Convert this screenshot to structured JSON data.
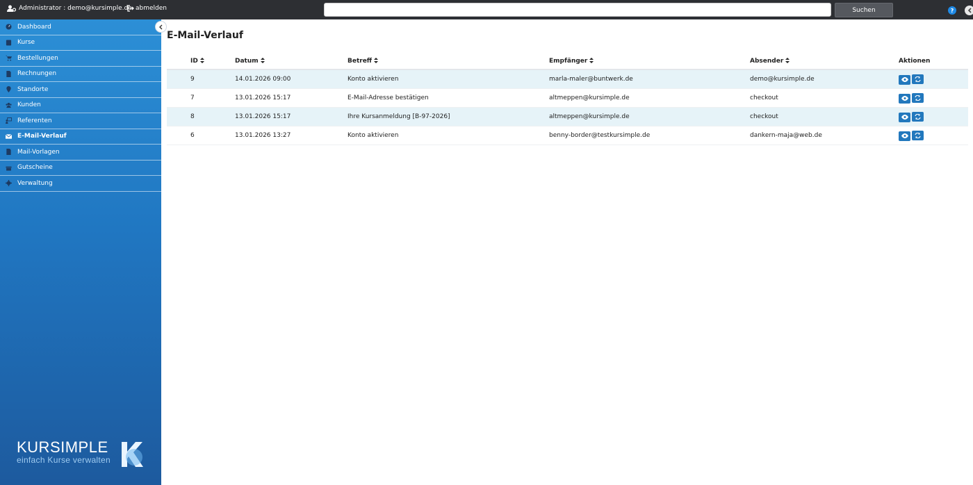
{
  "header": {
    "user_label": "Administrator : demo@kursimple.de",
    "logout_label": "abmelden",
    "search_placeholder": "",
    "search_button": "Suchen",
    "help_label": "?"
  },
  "sidebar": {
    "items": [
      {
        "label": "Dashboard",
        "icon": "dashboard-icon"
      },
      {
        "label": "Kurse",
        "icon": "book-icon"
      },
      {
        "label": "Bestellungen",
        "icon": "cart-icon"
      },
      {
        "label": "Rechnungen",
        "icon": "file-icon"
      },
      {
        "label": "Standorte",
        "icon": "map-marker-icon"
      },
      {
        "label": "Kunden",
        "icon": "users-icon"
      },
      {
        "label": "Referenten",
        "icon": "teacher-icon"
      },
      {
        "label": "E-Mail-Verlauf",
        "icon": "envelope-icon",
        "active": true
      },
      {
        "label": "Mail-Vorlagen",
        "icon": "document-icon"
      },
      {
        "label": "Gutscheine",
        "icon": "gift-icon"
      },
      {
        "label": "Verwaltung",
        "icon": "gear-icon"
      }
    ],
    "logo_name": "KURSIMPLE",
    "logo_tagline": "einfach Kurse verwalten"
  },
  "main": {
    "title": "E-Mail-Verlauf",
    "columns": {
      "id": "ID",
      "date": "Datum",
      "subject": "Betreff",
      "recipient": "Empfänger",
      "sender": "Absender",
      "actions": "Aktionen"
    },
    "rows": [
      {
        "id": "9",
        "date": "14.01.2026 09:00",
        "subject": "Konto aktivieren",
        "recipient": "marla-maler@buntwerk.de",
        "sender": "demo@kursimple.de"
      },
      {
        "id": "7",
        "date": "13.01.2026 15:17",
        "subject": "E-Mail-Adresse bestätigen",
        "recipient": "altmeppen@kursimple.de",
        "sender": "checkout"
      },
      {
        "id": "8",
        "date": "13.01.2026 15:17",
        "subject": "Ihre Kursanmeldung [B-97-2026]",
        "recipient": "altmeppen@kursimple.de",
        "sender": "checkout"
      },
      {
        "id": "6",
        "date": "13.01.2026 13:27",
        "subject": "Konto aktivieren",
        "recipient": "benny-border@testkursimple.de",
        "sender": "dankern-maja@web.de"
      }
    ]
  },
  "colors": {
    "topbar": "#2d2f33",
    "sidebar_top": "#2c8fd6",
    "sidebar_bottom": "#1d5a9e",
    "row_highlight": "#e6f3f8",
    "action_button": "#2278bd"
  }
}
